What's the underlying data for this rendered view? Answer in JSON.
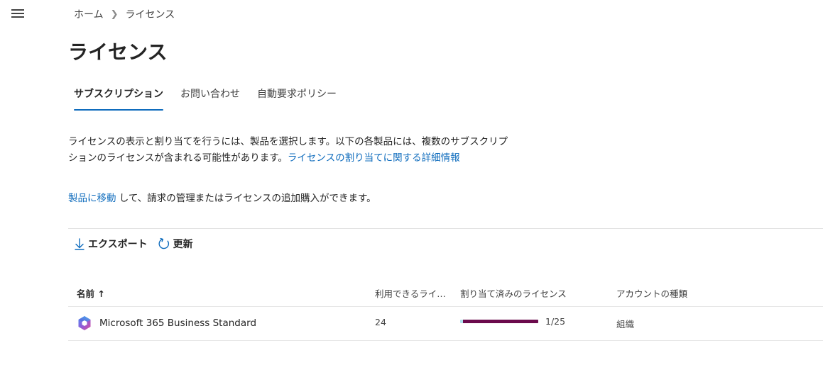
{
  "breadcrumb": {
    "home": "ホーム",
    "current": "ライセンス"
  },
  "page": {
    "title": "ライセンス"
  },
  "tabs": [
    {
      "label": "サブスクリプション",
      "active": true
    },
    {
      "label": "お問い合わせ",
      "active": false
    },
    {
      "label": "自動要求ポリシー",
      "active": false
    }
  ],
  "description": {
    "text": "ライセンスの表示と割り当てを行うには、製品を選択します。以下の各製品には、複数のサブスクリプションのライセンスが含まれる可能性があります。",
    "link": "ライセンスの割り当てに関する詳細情報"
  },
  "description2": {
    "link": "製品に移動",
    "text": " して、請求の管理またはライセンスの追加購入ができます。"
  },
  "toolbar": {
    "export_label": "エクスポート",
    "refresh_label": "更新"
  },
  "table": {
    "columns": {
      "name": "名前",
      "name_sort": "↑",
      "available": "利用できるライセンス",
      "assigned": "割り当て済みのライセンス",
      "account_type": "アカウントの種類"
    },
    "rows": [
      {
        "name": "Microsoft 365 Business Standard",
        "icon": "microsoft-365-icon",
        "available": "24",
        "assigned_label": "1/25",
        "assigned_fraction": 0.04,
        "account_type": "組織"
      }
    ]
  },
  "colors": {
    "accent": "#0f6cbd",
    "bar_track": "#b0e0ec",
    "bar_fill": "#6b0a4c"
  }
}
